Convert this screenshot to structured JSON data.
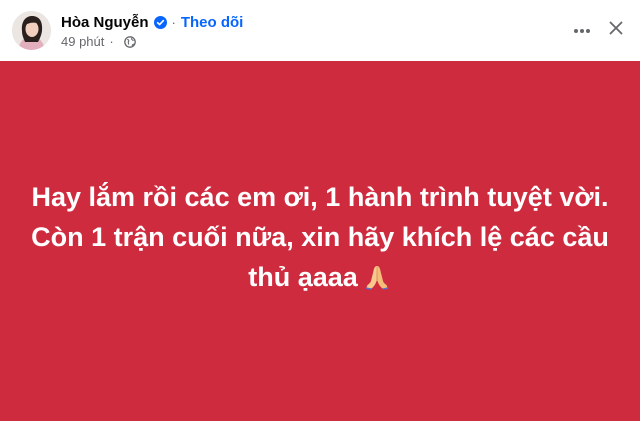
{
  "post": {
    "author_name": "Hòa Nguyễn",
    "follow_label": "Theo dõi",
    "separator": "·",
    "timestamp": "49 phút",
    "meta_separator": "·",
    "text_line1": "Hay lắm rồi các em ơi, 1 hành trình tuyệt vời.",
    "text_line2": "Còn 1 trận cuối nữa, xin hãy khích lệ các cầu",
    "text_line3": "thủ ạaaa",
    "background_color": "#cf2b3f",
    "emoji": "folded-hands-icon"
  },
  "icons": {
    "verified": "verified-badge-icon",
    "privacy": "globe-icon",
    "more": "more-options-icon",
    "close": "close-icon"
  },
  "colors": {
    "accent": "#0866ff",
    "secondary_text": "#65676b",
    "primary_text": "#050505"
  }
}
